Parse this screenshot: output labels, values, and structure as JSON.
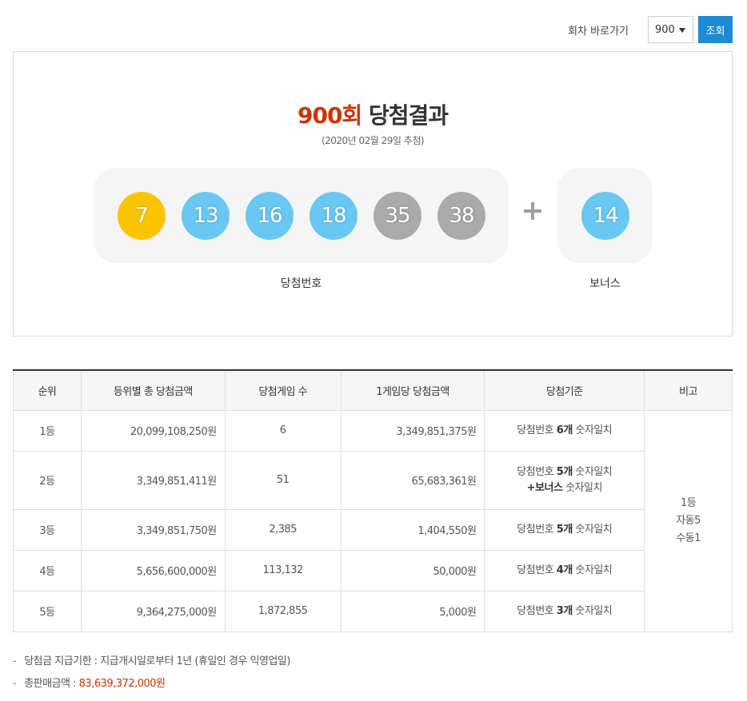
{
  "nav": {
    "label": "회차 바로가기",
    "selected_round": "900",
    "button": "조회"
  },
  "result": {
    "round_number": "900회",
    "title_suffix": "당첨결과",
    "draw_date": "(2020년 02월 29일 추첨)",
    "win_numbers": [
      "7",
      "13",
      "16",
      "18",
      "35",
      "38"
    ],
    "bonus_number": "14",
    "win_caption": "당첨번호",
    "bonus_caption": "보너스",
    "ball_colors": {
      "yellow": "#fbc400",
      "blue": "#69c8f2",
      "gray": "#aaaaaa"
    }
  },
  "table": {
    "headers": [
      "순위",
      "등위별 총 당첨금액",
      "당첨게임 수",
      "1게임당 당첨금액",
      "당첨기준",
      "비고"
    ],
    "rows": [
      {
        "rank": "1등",
        "total": "20,099,108,250원",
        "winners": "6",
        "per_game": "3,349,851,375원",
        "crit_pre": "당첨번호 ",
        "crit_bold": "6개",
        "crit_post": " 숫자일치"
      },
      {
        "rank": "2등",
        "total": "3,349,851,411원",
        "winners": "51",
        "per_game": "65,683,361원",
        "crit_pre": "당첨번호 ",
        "crit_bold": "5개",
        "crit_post": " 숫자일치",
        "crit2_bold": "+보너스",
        "crit2_post": " 숫자일치"
      },
      {
        "rank": "3등",
        "total": "3,349,851,750원",
        "winners": "2,385",
        "per_game": "1,404,550원",
        "crit_pre": "당첨번호 ",
        "crit_bold": "5개",
        "crit_post": " 숫자일치"
      },
      {
        "rank": "4등",
        "total": "5,656,600,000원",
        "winners": "113,132",
        "per_game": "50,000원",
        "crit_pre": "당첨번호 ",
        "crit_bold": "4개",
        "crit_post": " 숫자일치"
      },
      {
        "rank": "5등",
        "total": "9,364,275,000원",
        "winners": "1,872,855",
        "per_game": "5,000원",
        "crit_pre": "당첨번호 ",
        "crit_bold": "3개",
        "crit_post": " 숫자일치"
      }
    ],
    "note": [
      "1등",
      "자동5",
      "수동1"
    ]
  },
  "footer": {
    "deadline": "당첨금 지급기한 : 지급개시일로부터 1년 (휴일인 경우 익영업일)",
    "sales_label": "총판매금액 : ",
    "sales_amount": "83,639,372,000원"
  }
}
